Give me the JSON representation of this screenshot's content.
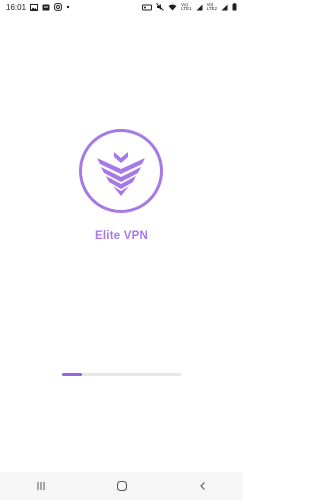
{
  "status_bar": {
    "time": "16:01",
    "network_label_top": "Vo)",
    "network_label_bottom": "LTE1",
    "network2_label_top": "Vo)",
    "network2_label_bottom": "LTE2"
  },
  "splash": {
    "app_name": "Elite VPN",
    "logo_color": "#a679e6",
    "progress_fraction": 0.17
  },
  "nav_bar": {
    "icons": [
      "recent-apps-icon",
      "home-icon",
      "back-icon"
    ]
  }
}
